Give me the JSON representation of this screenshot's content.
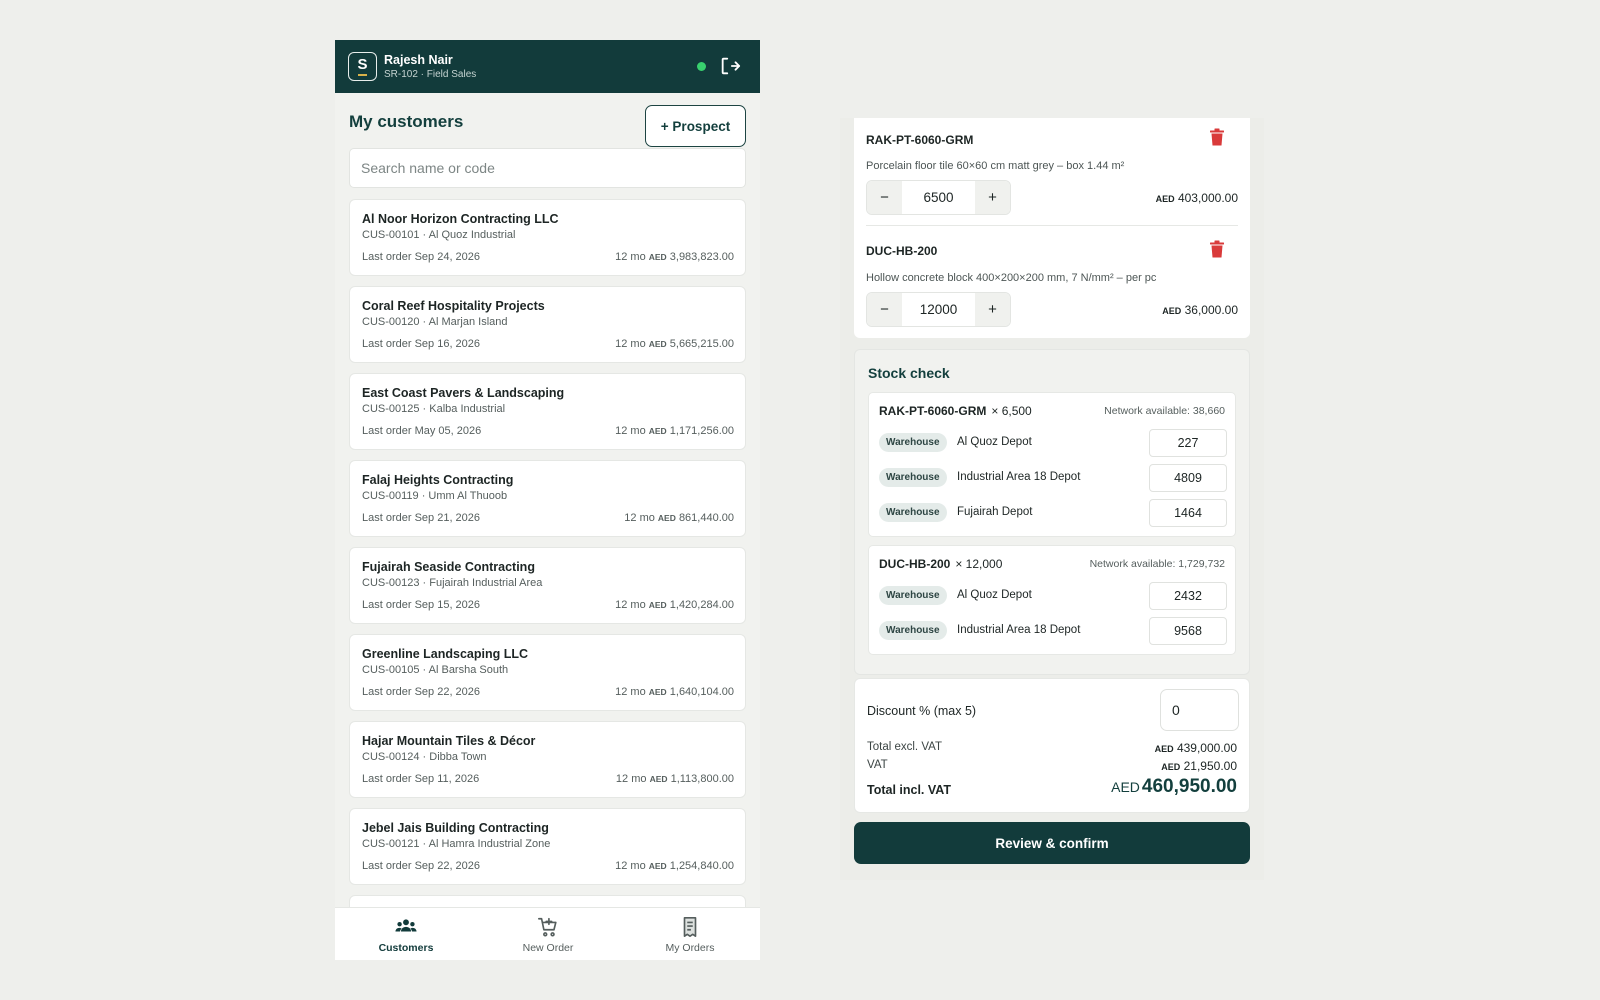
{
  "header": {
    "logo_letter": "S",
    "user_name": "Rajesh Nair",
    "user_role": "SR-102 · Field Sales",
    "status_color": "#38d06e",
    "brand_color": "#123b3b"
  },
  "customers_page": {
    "title": "My customers",
    "prospect_button": "+ Prospect",
    "search_placeholder": "Search name or code",
    "currency_prefix": "12 mo",
    "currency": "AED",
    "customers": [
      {
        "name": "Al Noor Horizon Contracting LLC",
        "code_area": "CUS-00101 · Al Quoz Industrial",
        "last_order": "Last order Sep 24, 2026",
        "amount": "3,983,823.00"
      },
      {
        "name": "Coral Reef Hospitality Projects",
        "code_area": "CUS-00120 · Al Marjan Island",
        "last_order": "Last order Sep 16, 2026",
        "amount": "5,665,215.00"
      },
      {
        "name": "East Coast Pavers & Landscaping",
        "code_area": "CUS-00125 · Kalba Industrial",
        "last_order": "Last order May 05, 2026",
        "amount": "1,171,256.00"
      },
      {
        "name": "Falaj Heights Contracting",
        "code_area": "CUS-00119 · Umm Al Thuoob",
        "last_order": "Last order Sep 21, 2026",
        "amount": "861,440.00"
      },
      {
        "name": "Fujairah Seaside Contracting",
        "code_area": "CUS-00123 · Fujairah Industrial Area",
        "last_order": "Last order Sep 15, 2026",
        "amount": "1,420,284.00"
      },
      {
        "name": "Greenline Landscaping LLC",
        "code_area": "CUS-00105 · Al Barsha South",
        "last_order": "Last order Sep 22, 2026",
        "amount": "1,640,104.00"
      },
      {
        "name": "Hajar Mountain Tiles & Décor",
        "code_area": "CUS-00124 · Dibba Town",
        "last_order": "Last order Sep 11, 2026",
        "amount": "1,113,800.00"
      },
      {
        "name": "Jebel Jais Building Contracting",
        "code_area": "CUS-00121 · Al Hamra Industrial Zone",
        "last_order": "Last order Sep 22, 2026",
        "amount": "1,254,840.00"
      }
    ]
  },
  "bottom_nav": {
    "items": [
      {
        "label": "Customers",
        "icon": "users-icon",
        "active": true
      },
      {
        "label": "New Order",
        "icon": "cart-icon",
        "active": false
      },
      {
        "label": "My Orders",
        "icon": "receipt-icon",
        "active": false
      }
    ]
  },
  "order": {
    "minus_label": "−",
    "plus_label": "+",
    "currency": "AED",
    "lines": [
      {
        "sku": "RAK-PT-6060-GRM",
        "description": "Porcelain floor tile 60×60 cm matt grey – box 1.44 m²",
        "quantity": "6500",
        "line_total": "403,000.00"
      },
      {
        "sku": "DUC-HB-200",
        "description": "Hollow concrete block 400×200×200 mm, 7 N/mm² – per pc",
        "quantity": "12000",
        "line_total": "36,000.00"
      }
    ],
    "delete_color": "#d93a3a"
  },
  "stock_check": {
    "title": "Stock check",
    "badge_label": "Warehouse",
    "items": [
      {
        "sku": "RAK-PT-6060-GRM",
        "qty": "× 6,500",
        "network": "Network available: 38,660",
        "warehouses": [
          {
            "name": "Al Quoz Depot",
            "qty": "227"
          },
          {
            "name": "Industrial Area 18 Depot",
            "qty": "4809"
          },
          {
            "name": "Fujairah Depot",
            "qty": "1464"
          }
        ]
      },
      {
        "sku": "DUC-HB-200",
        "qty": "× 12,000",
        "network": "Network available: 1,729,732",
        "warehouses": [
          {
            "name": "Al Quoz Depot",
            "qty": "2432"
          },
          {
            "name": "Industrial Area 18 Depot",
            "qty": "9568"
          }
        ]
      }
    ]
  },
  "totals": {
    "discount_label": "Discount % (max 5)",
    "discount_value": "0",
    "excl_label": "Total excl. VAT",
    "excl_value": "439,000.00",
    "vat_label": "VAT",
    "vat_value": "21,950.00",
    "incl_label": "Total incl. VAT",
    "incl_value": "460,950.00",
    "currency": "AED"
  },
  "confirm_button": "Review & confirm"
}
